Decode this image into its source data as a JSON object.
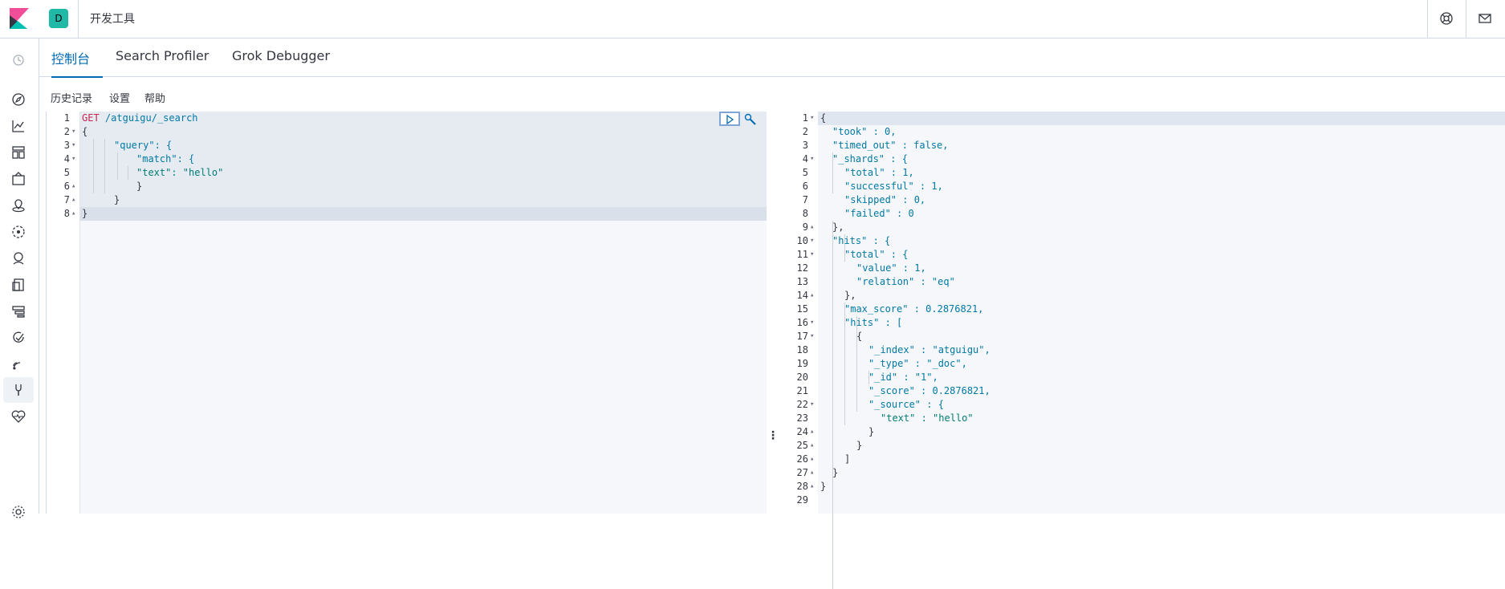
{
  "header": {
    "space_initial": "D",
    "breadcrumb": "开发工具",
    "help_icon": "help-lifebuoy-icon",
    "mail_icon": "mail-icon"
  },
  "sidenav": {
    "icons": [
      "recent-clock-icon",
      "discover-compass-icon",
      "visualize-chart-icon",
      "dashboard-icon",
      "canvas-icon",
      "maps-icon",
      "machine-learning-icon",
      "infrastructure-icon",
      "logs-icon",
      "apm-icon",
      "uptime-icon",
      "siem-icon",
      "dev-tools-icon",
      "monitoring-icon",
      "management-gear-icon"
    ]
  },
  "tabs": [
    {
      "label": "控制台",
      "active": true
    },
    {
      "label": "Search Profiler",
      "active": false
    },
    {
      "label": "Grok Debugger",
      "active": false
    }
  ],
  "toolbar": {
    "history": "历史记录",
    "settings": "设置",
    "help": "帮助"
  },
  "request": {
    "method": "GET",
    "path": "/atguigu/_search",
    "lines": [
      {
        "n": "1",
        "fold": "",
        "text": "GET /atguigu/_search"
      },
      {
        "n": "2",
        "fold": "▾",
        "text": "{"
      },
      {
        "n": "3",
        "fold": "▾",
        "text": "\"query\": {"
      },
      {
        "n": "4",
        "fold": "▾",
        "text": "\"match\": {"
      },
      {
        "n": "5",
        "fold": "",
        "text": "\"text\": \"hello\""
      },
      {
        "n": "6",
        "fold": "▴",
        "text": "}"
      },
      {
        "n": "7",
        "fold": "▴",
        "text": "}"
      },
      {
        "n": "8",
        "fold": "▴",
        "text": "}"
      }
    ]
  },
  "response": {
    "lines": [
      {
        "n": "1",
        "fold": "▾",
        "text": "{"
      },
      {
        "n": "2",
        "fold": "",
        "text": "\"took\" : 0,"
      },
      {
        "n": "3",
        "fold": "",
        "text": "\"timed_out\" : false,"
      },
      {
        "n": "4",
        "fold": "▾",
        "text": "\"_shards\" : {"
      },
      {
        "n": "5",
        "fold": "",
        "text": "\"total\" : 1,"
      },
      {
        "n": "6",
        "fold": "",
        "text": "\"successful\" : 1,"
      },
      {
        "n": "7",
        "fold": "",
        "text": "\"skipped\" : 0,"
      },
      {
        "n": "8",
        "fold": "",
        "text": "\"failed\" : 0"
      },
      {
        "n": "9",
        "fold": "▴",
        "text": "},"
      },
      {
        "n": "10",
        "fold": "▾",
        "text": "\"hits\" : {"
      },
      {
        "n": "11",
        "fold": "▾",
        "text": "\"total\" : {"
      },
      {
        "n": "12",
        "fold": "",
        "text": "\"value\" : 1,"
      },
      {
        "n": "13",
        "fold": "",
        "text": "\"relation\" : \"eq\""
      },
      {
        "n": "14",
        "fold": "▴",
        "text": "},"
      },
      {
        "n": "15",
        "fold": "",
        "text": "\"max_score\" : 0.2876821,"
      },
      {
        "n": "16",
        "fold": "▾",
        "text": "\"hits\" : ["
      },
      {
        "n": "17",
        "fold": "▾",
        "text": "{"
      },
      {
        "n": "18",
        "fold": "",
        "text": "\"_index\" : \"atguigu\","
      },
      {
        "n": "19",
        "fold": "",
        "text": "\"_type\" : \"_doc\","
      },
      {
        "n": "20",
        "fold": "",
        "text": "\"_id\" : \"1\","
      },
      {
        "n": "21",
        "fold": "",
        "text": "\"_score\" : 0.2876821,"
      },
      {
        "n": "22",
        "fold": "▾",
        "text": "\"_source\" : {"
      },
      {
        "n": "23",
        "fold": "",
        "text": "\"text\" : \"hello\""
      },
      {
        "n": "24",
        "fold": "▴",
        "text": "}"
      },
      {
        "n": "25",
        "fold": "▴",
        "text": "}"
      },
      {
        "n": "26",
        "fold": "▴",
        "text": "]"
      },
      {
        "n": "27",
        "fold": "▴",
        "text": "}"
      },
      {
        "n": "28",
        "fold": "▴",
        "text": "}"
      },
      {
        "n": "29",
        "fold": "",
        "text": ""
      }
    ]
  },
  "colors": {
    "accent": "#006bb4",
    "space_badge": "#20b9a8",
    "method": "#c7254e",
    "string": "#017d73",
    "key": "#0079a5",
    "boolean": "#6f5ad1"
  }
}
